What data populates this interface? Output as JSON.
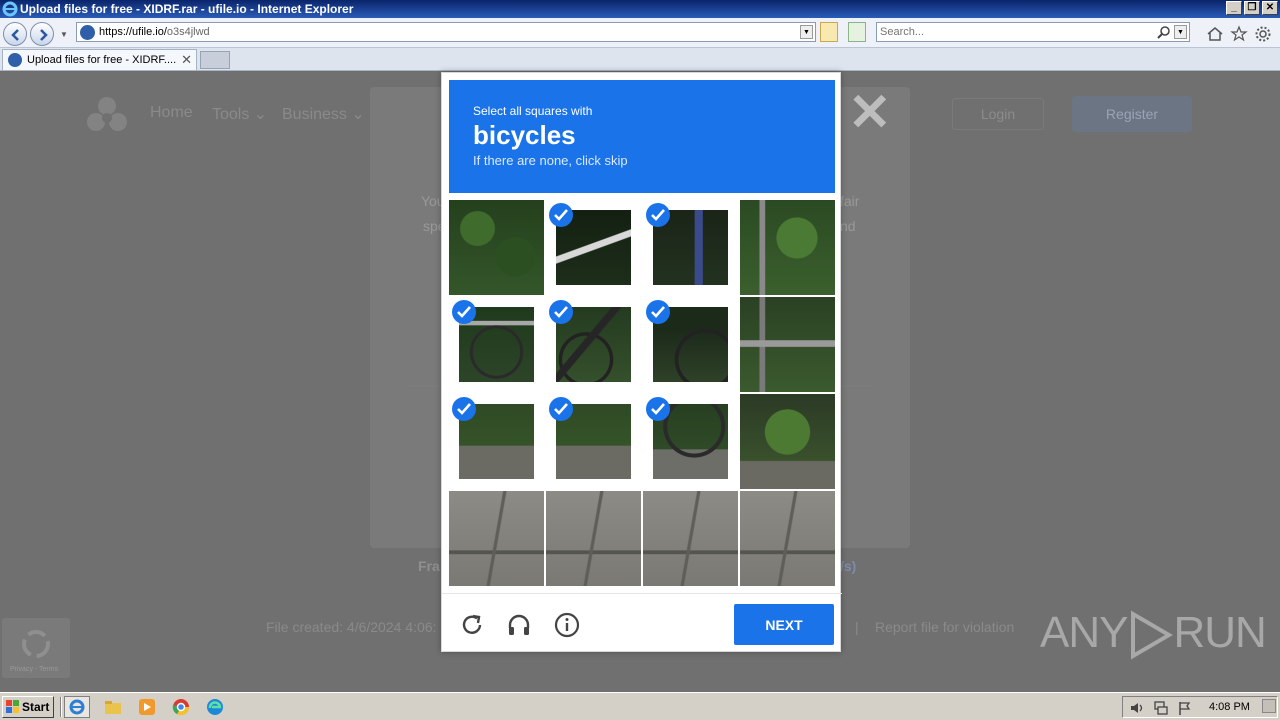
{
  "window": {
    "title": "Upload files for free - XIDRF.rar - ufile.io - Internet Explorer",
    "controls": [
      "_",
      "❐",
      "✕"
    ]
  },
  "address_bar": {
    "url_host": "https://ufile.io/",
    "url_path": "o3s4jlwd",
    "search_placeholder": "Search..."
  },
  "tabs": [
    {
      "label": "Upload files for free - XIDRF....",
      "close": "✕"
    }
  ],
  "site": {
    "nav": [
      "Home",
      "Tools ⌄",
      "Business ⌄"
    ],
    "login": "Login",
    "register": "Register",
    "modal_close": "✕",
    "modal_text_left_1": "You",
    "modal_text_left_2": "spe",
    "modal_text_right_1": "fair",
    "modal_text_right_2": "nd",
    "free_download": "Fra",
    "download_speed": "/s)",
    "file_created": "File created: 4/6/2024 4:06:",
    "separator": "|",
    "report": "Report file for violation",
    "recaptcha_badge": "Privacy - Terms"
  },
  "captcha": {
    "prompt": "Select all squares with",
    "object": "bicycles",
    "hint": "If there are none, click skip",
    "next_label": "NEXT",
    "accent": "#1a73e8",
    "cells": [
      {
        "selected": false,
        "scene": "foliage"
      },
      {
        "selected": true,
        "scene": "bike-handle"
      },
      {
        "selected": true,
        "scene": "dark-post"
      },
      {
        "selected": false,
        "scene": "foliage-fence"
      },
      {
        "selected": true,
        "scene": "bike-wheel"
      },
      {
        "selected": true,
        "scene": "bike-frame"
      },
      {
        "selected": true,
        "scene": "bike-rear"
      },
      {
        "selected": false,
        "scene": "fence-bush"
      },
      {
        "selected": true,
        "scene": "curb-grass"
      },
      {
        "selected": true,
        "scene": "curb-grass"
      },
      {
        "selected": true,
        "scene": "bike-wheel-low"
      },
      {
        "selected": false,
        "scene": "bush-curb"
      },
      {
        "selected": false,
        "scene": "pavement"
      },
      {
        "selected": false,
        "scene": "pavement"
      },
      {
        "selected": false,
        "scene": "pavement"
      },
      {
        "selected": false,
        "scene": "pavement"
      }
    ],
    "footer_icons": [
      "refresh-icon",
      "headphones-icon",
      "info-icon"
    ]
  },
  "watermark": {
    "left": "ANY",
    "right": "RUN"
  },
  "taskbar": {
    "start_label": "Start",
    "clock": "4:08 PM",
    "apps": [
      "internet-explorer-icon",
      "file-explorer-icon",
      "media-player-icon",
      "chrome-icon",
      "edge-icon"
    ]
  }
}
